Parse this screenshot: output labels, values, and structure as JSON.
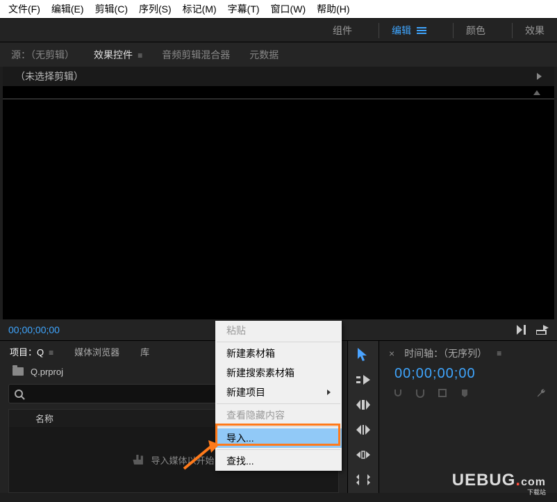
{
  "menubar": {
    "file": "文件(F)",
    "edit": "编辑(E)",
    "clip": "剪辑(C)",
    "sequence": "序列(S)",
    "marker": "标记(M)",
    "title": "字幕(T)",
    "window": "窗口(W)",
    "help": "帮助(H)"
  },
  "workspaces": {
    "assembly": "组件",
    "editing": "编辑",
    "color": "颜色",
    "effects": "效果"
  },
  "source_tabs": {
    "source": "源：（无剪辑）",
    "effect_controls": "效果控件",
    "audio_mixer": "音频剪辑混合器",
    "metadata": "元数据"
  },
  "effect_panel": {
    "placeholder": "（未选择剪辑）"
  },
  "timecode": {
    "source_tc": "00;00;00;00"
  },
  "project": {
    "tab_project": "项目：Q",
    "tab_media_browser": "媒体浏览器",
    "tab_library": "库",
    "filename": "Q.prproj",
    "column_name": "名称",
    "import_hint": "导入媒体以开始"
  },
  "timeline": {
    "title": "时间轴：（无序列）",
    "tc": "00;00;00;00"
  },
  "context_menu": {
    "paste": "粘贴",
    "new_bin": "新建素材箱",
    "new_search_bin": "新建搜索素材箱",
    "new_item": "新建项目",
    "view_hidden": "查看隐藏内容",
    "import": "导入...",
    "find": "查找..."
  },
  "watermark": {
    "brand": "UEBUG",
    "suffix": ".com",
    "tag": "下载站"
  }
}
